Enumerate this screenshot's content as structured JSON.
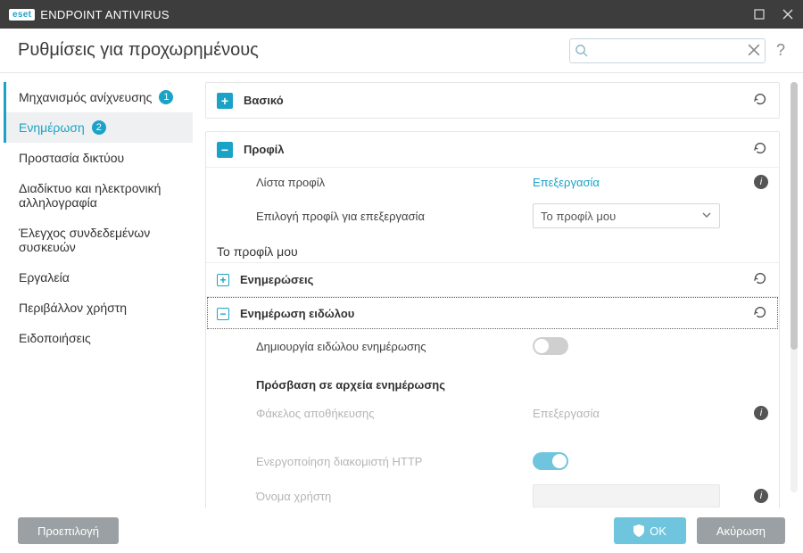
{
  "window": {
    "brand_short": "eset",
    "product": "ENDPOINT ANTIVIRUS"
  },
  "subheader": {
    "title": "Ρυθμίσεις για προχωρημένους",
    "search_placeholder": "",
    "help": "?"
  },
  "sidebar": {
    "items": [
      {
        "label": "Μηχανισμός ανίχνευσης",
        "badge": "1"
      },
      {
        "label": "Ενημέρωση",
        "badge": "2"
      },
      {
        "label": "Προστασία δικτύου"
      },
      {
        "label": "Διαδίκτυο και ηλεκτρονική αλληλογραφία"
      },
      {
        "label": "Έλεγχος συνδεδεμένων συσκευών"
      },
      {
        "label": "Εργαλεία"
      },
      {
        "label": "Περιβάλλον χρήστη"
      },
      {
        "label": "Ειδοποιήσεις"
      }
    ]
  },
  "main": {
    "basic": {
      "title": "Βασικό"
    },
    "profile": {
      "title": "Προφίλ",
      "list_label": "Λίστα προφίλ",
      "list_action": "Επεξεργασία",
      "select_label": "Επιλογή προφίλ για επεξεργασία",
      "select_value": "Το προφίλ μου",
      "current_profile": "Το προφίλ μου",
      "updates_title": "Ενημερώσεις",
      "mirror": {
        "title": "Ενημέρωση ειδώλου",
        "create_label": "Δημιουργία ειδώλου ενημέρωσης",
        "create_on": false,
        "access_title": "Πρόσβαση σε αρχεία ενημέρωσης",
        "folder_label": "Φάκελος αποθήκευσης",
        "folder_action": "Επεξεργασία",
        "http_label": "Ενεργοποίηση διακομιστή HTTP",
        "http_on": true,
        "username_label": "Όνομα χρήστη"
      }
    }
  },
  "footer": {
    "default": "Προεπιλογή",
    "ok": "OK",
    "cancel": "Ακύρωση"
  },
  "icons": {
    "plus": "+",
    "minus": "−",
    "info": "i"
  }
}
